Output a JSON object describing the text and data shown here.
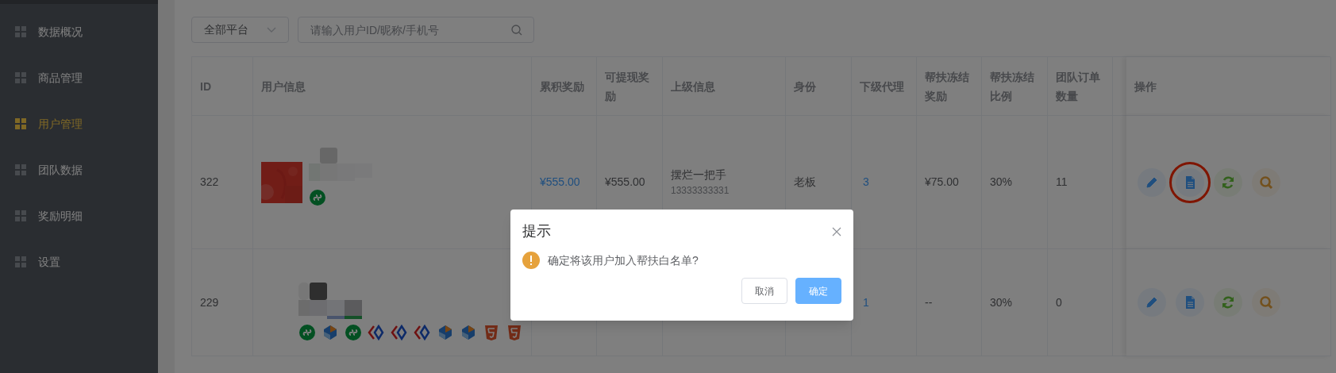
{
  "sidebar": {
    "items": [
      {
        "label": "数据概况",
        "selected": false
      },
      {
        "label": "商品管理",
        "selected": false
      },
      {
        "label": "用户管理",
        "selected": true
      },
      {
        "label": "团队数据",
        "selected": false
      },
      {
        "label": "奖励明细",
        "selected": false
      },
      {
        "label": "设置",
        "selected": false
      }
    ]
  },
  "filters": {
    "platform_select": {
      "value": "全部平台"
    },
    "search": {
      "placeholder": "请输入用户ID/昵称/手机号"
    }
  },
  "table": {
    "columns": [
      "ID",
      "用户信息",
      "累积奖励",
      "可提现奖励",
      "上级信息",
      "身份",
      "下级代理",
      "帮扶冻结奖励",
      "帮扶冻结比例",
      "团队订单数量",
      "操作"
    ],
    "rows": [
      {
        "id": "322",
        "avatar": {
          "kind": "picture"
        },
        "platforms": [
          {
            "kind": "miniprogram"
          }
        ],
        "total_reward": "¥555.00",
        "withdrawable": "¥555.00",
        "parent_name": "摆烂一把手",
        "parent_phone": "13333333331",
        "role": "老板",
        "sub_agents": "3",
        "frozen_reward": "¥75.00",
        "frozen_ratio": "30%",
        "team_orders": "11",
        "actions": [
          {
            "kind": "edit",
            "highlighted": false
          },
          {
            "kind": "document",
            "highlighted": true
          },
          {
            "kind": "refresh",
            "highlighted": false
          },
          {
            "kind": "search",
            "highlighted": false
          }
        ]
      },
      {
        "id": "229",
        "platforms": [
          {
            "kind": "miniprogram"
          },
          {
            "kind": "cube"
          },
          {
            "kind": "miniprogram"
          },
          {
            "kind": "chevron"
          },
          {
            "kind": "chevron"
          },
          {
            "kind": "chevron"
          },
          {
            "kind": "cube"
          },
          {
            "kind": "cube"
          },
          {
            "kind": "html5"
          },
          {
            "kind": "html5"
          }
        ],
        "sub_agents": "1",
        "frozen_reward": "--",
        "frozen_ratio": "30%",
        "team_orders": "0",
        "actions": [
          {
            "kind": "edit",
            "highlighted": false
          },
          {
            "kind": "document",
            "highlighted": false
          },
          {
            "kind": "refresh",
            "highlighted": false
          },
          {
            "kind": "search",
            "highlighted": false
          }
        ]
      }
    ]
  },
  "dialog": {
    "title": "提示",
    "message": "确定将该用户加入帮扶白名单?",
    "buttons": [
      {
        "label": "取消",
        "kind": "default"
      },
      {
        "label": "确定",
        "kind": "primary"
      }
    ]
  }
}
